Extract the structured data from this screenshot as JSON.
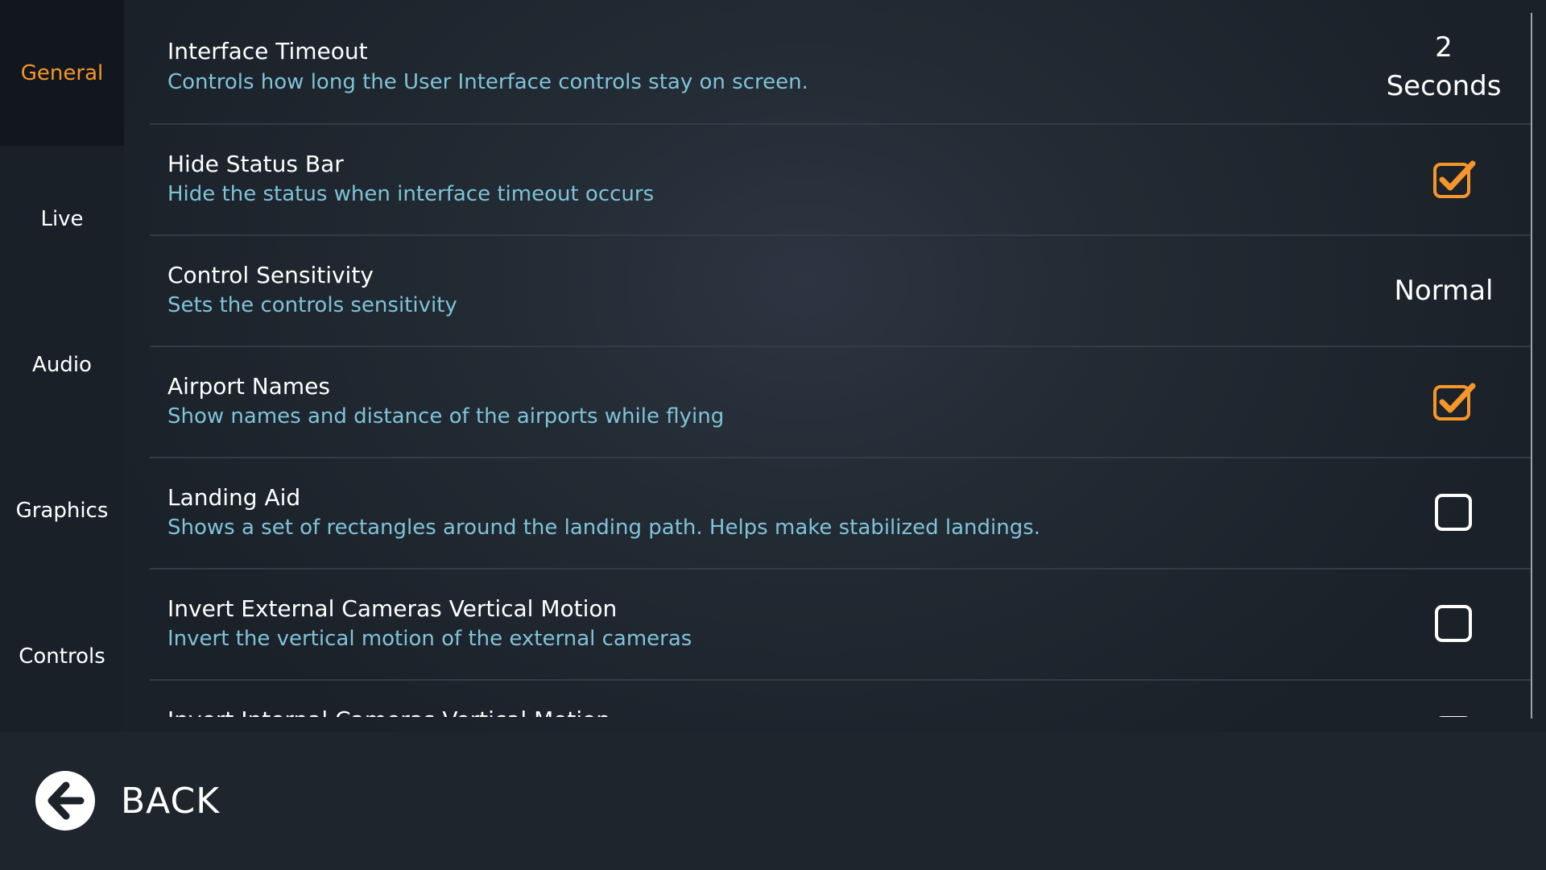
{
  "sidebar": {
    "items": [
      {
        "label": "General",
        "active": true
      },
      {
        "label": "Live",
        "active": false
      },
      {
        "label": "Audio",
        "active": false
      },
      {
        "label": "Graphics",
        "active": false
      },
      {
        "label": "Controls",
        "active": false
      }
    ]
  },
  "settings": [
    {
      "title": "Interface Timeout",
      "description": "Controls how long the User Interface controls stay on screen.",
      "value_number": "2",
      "value_unit": "Seconds"
    },
    {
      "title": "Hide Status Bar",
      "description": "Hide the status when interface timeout occurs",
      "checked": true
    },
    {
      "title": "Control Sensitivity",
      "description": "Sets the controls sensitivity",
      "value": "Normal"
    },
    {
      "title": "Airport Names",
      "description": "Show names and distance of the airports while flying",
      "checked": true
    },
    {
      "title": "Landing Aid",
      "description": "Shows a set of rectangles around the landing path. Helps make stabilized landings.",
      "checked": false
    },
    {
      "title": "Invert External Cameras Vertical Motion",
      "description": "Invert the vertical motion of the external cameras",
      "checked": false
    },
    {
      "title": "Invert Internal Cameras Vertical Motion",
      "description": "",
      "checked": false
    }
  ],
  "footer": {
    "back_label": "BACK"
  },
  "colors": {
    "accent": "#f5962a",
    "description": "#7fc3d8",
    "text": "#ffffff"
  },
  "icons": {
    "back": "arrow-left-circle-icon",
    "checked": "checkbox-checked-icon",
    "unchecked": "checkbox-unchecked-icon"
  }
}
